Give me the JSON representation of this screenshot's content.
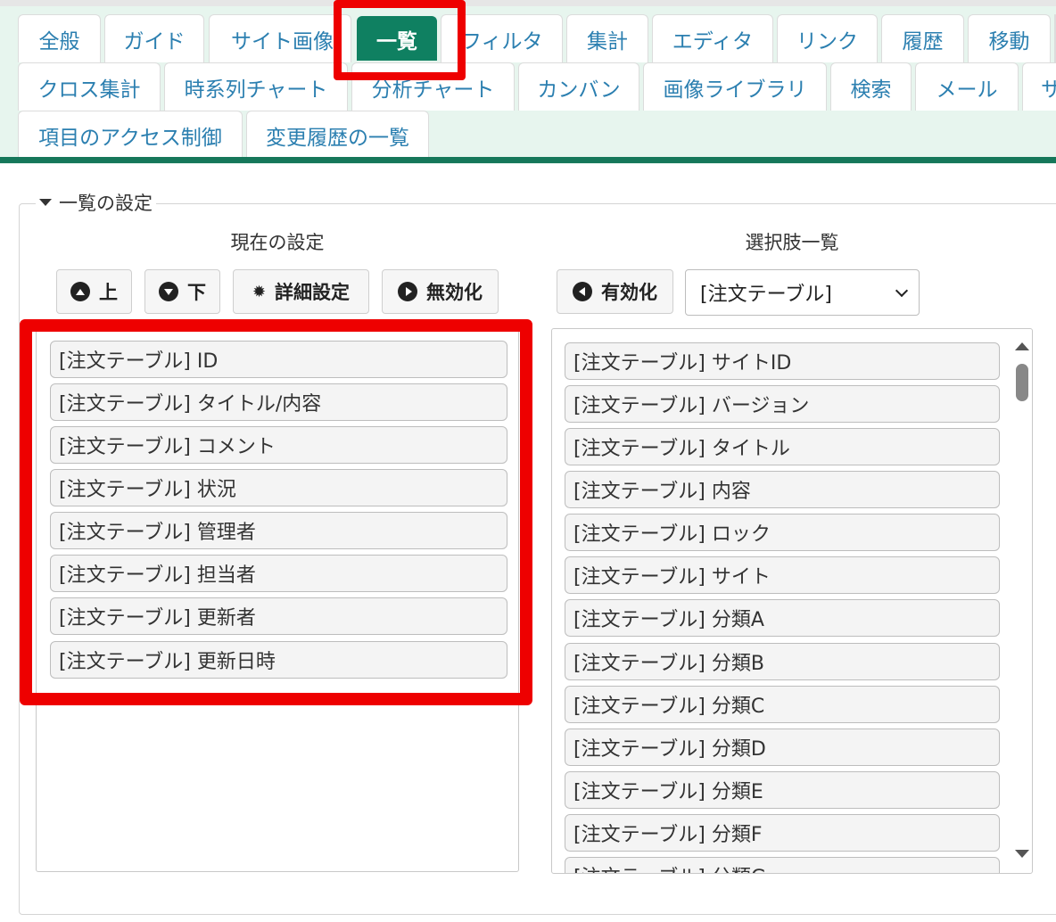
{
  "tabs": {
    "row1": [
      "全般",
      "ガイド",
      "サイト画像",
      "一覧",
      "フィルタ",
      "集計",
      "エディタ",
      "リンク",
      "履歴",
      "移動"
    ],
    "row2": [
      "クロス集計",
      "時系列チャート",
      "分析チャート",
      "カンバン",
      "画像ライブラリ",
      "検索",
      "メール",
      "サ"
    ],
    "row3": [
      "項目のアクセス制御",
      "変更履歴の一覧"
    ],
    "active": "一覧"
  },
  "section": {
    "legend": "一覧の設定",
    "current_title": "現在の設定",
    "options_title": "選択肢一覧"
  },
  "buttons": {
    "up": "上",
    "down": "下",
    "detail": "詳細設定",
    "disable": "無効化",
    "enable": "有効化"
  },
  "select": {
    "value": "[注文テーブル]"
  },
  "current_columns": [
    "[注文テーブル] ID",
    "[注文テーブル] タイトル/内容",
    "[注文テーブル] コメント",
    "[注文テーブル] 状況",
    "[注文テーブル] 管理者",
    "[注文テーブル] 担当者",
    "[注文テーブル] 更新者",
    "[注文テーブル] 更新日時"
  ],
  "option_columns": [
    "[注文テーブル] サイトID",
    "[注文テーブル] バージョン",
    "[注文テーブル] タイトル",
    "[注文テーブル] 内容",
    "[注文テーブル] ロック",
    "[注文テーブル] サイト",
    "[注文テーブル] 分類A",
    "[注文テーブル] 分類B",
    "[注文テーブル] 分類C",
    "[注文テーブル] 分類D",
    "[注文テーブル] 分類E",
    "[注文テーブル] 分類F",
    "[注文テーブル] 分類G"
  ],
  "colors": {
    "accent": "#0f8061",
    "tab_text": "#2b7fb0",
    "highlight": "#ee0000"
  }
}
